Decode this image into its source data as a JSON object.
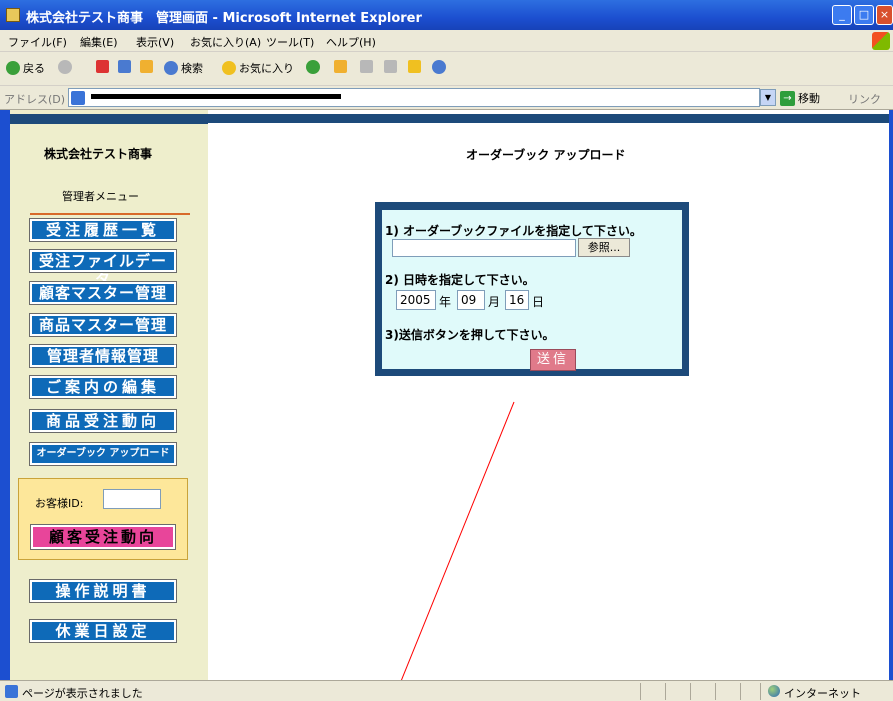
{
  "window": {
    "title": "株式会社テスト商事　管理画面 - Microsoft Internet Explorer",
    "min_glyph": "_",
    "max_glyph": "□",
    "close_glyph": "×"
  },
  "menubar": [
    "ファイル(F)",
    "編集(E)",
    "表示(V)",
    "お気に入り(A)",
    "ツール(T)",
    "ヘルプ(H)"
  ],
  "toolbar": {
    "back": "戻る",
    "search": "検索",
    "favorites": "お気に入り"
  },
  "address": {
    "label": "アドレス(D)",
    "go": "移動",
    "links": "リンク"
  },
  "sidebar": {
    "company": "株式会社テスト商事",
    "menu_label": "管理者メニュー",
    "buttons": [
      "受注履歴一覧",
      "受注ファイルデータ",
      "顧客マスター管理",
      "商品マスター管理",
      "管理者情報管理",
      "ご案内の編集",
      "商品受注動向",
      "オーダーブック アップロード"
    ],
    "customer_id_label": "お客様ID:",
    "customer_button": "顧客受注動向",
    "manual_button": "操作説明書",
    "holiday_button": "休業日設定"
  },
  "main": {
    "title": "オーダーブック アップロード",
    "step1": "1) オーダーブックファイルを指定して下さい。",
    "browse": "参照...",
    "step2": "2) 日時を指定して下さい。",
    "year": "2005",
    "year_unit": "年",
    "month": "09",
    "month_unit": "月",
    "day": "16",
    "day_unit": "日",
    "step3": "3)送信ボタンを押して下さい。",
    "submit": "送信"
  },
  "status": {
    "text": "ページが表示されました",
    "zone": "インターネット"
  },
  "colors": {
    "nav_button": "#0e6ab8",
    "customer_button": "#e8459a",
    "header_bar": "#1d4a7a",
    "sidebar_bg": "#eeeecc",
    "upload_bg": "#e0fafa",
    "annotation_line": "#ff0000"
  }
}
